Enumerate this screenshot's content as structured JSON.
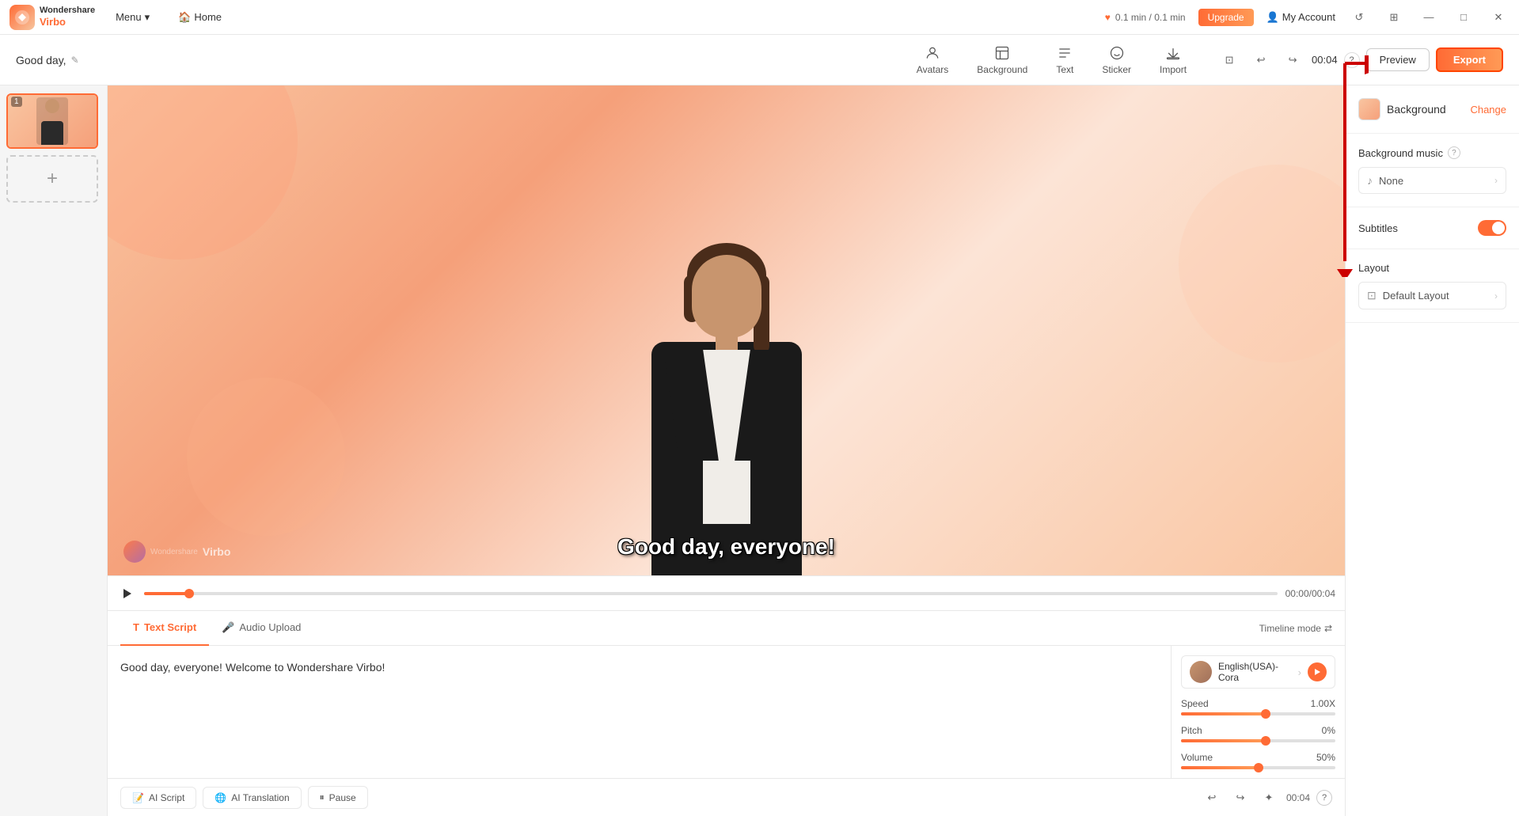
{
  "app": {
    "logo_text": "Wondershare\nVirbo",
    "logo_abbr": "W"
  },
  "top_nav": {
    "menu_label": "Menu",
    "home_label": "Home",
    "time_info": "0.1 min / 0.1 min",
    "upgrade_label": "Upgrade",
    "account_label": "My Account"
  },
  "toolbar": {
    "good_day_label": "Good day,",
    "avatars_label": "Avatars",
    "background_label": "Background",
    "text_label": "Text",
    "sticker_label": "Sticker",
    "import_label": "Import",
    "time_display": "00:04",
    "preview_label": "Preview",
    "export_label": "Export"
  },
  "slides": {
    "items": [
      {
        "num": "1",
        "label": "Slide 1"
      }
    ],
    "add_label": "+"
  },
  "canvas": {
    "subtitle_text": "Good day, everyone!",
    "watermark_text": "Virbo"
  },
  "timeline": {
    "time_display": "00:00/00:04",
    "progress_percent": 4
  },
  "script": {
    "text_script_label": "Text Script",
    "audio_upload_label": "Audio Upload",
    "timeline_mode_label": "Timeline mode",
    "script_content": "Good day, everyone! Welcome to Wondershare Virbo!",
    "voice_name": "English(USA)-Cora",
    "speed_label": "Speed",
    "speed_value": "1.00X",
    "pitch_label": "Pitch",
    "pitch_value": "0%",
    "volume_label": "Volume",
    "volume_value": "50%",
    "speed_percent": 55,
    "pitch_percent": 55,
    "volume_percent": 50
  },
  "bottom_toolbar": {
    "ai_script_label": "AI Script",
    "ai_translation_label": "AI Translation",
    "pause_label": "Pause",
    "time_badge": "00:04"
  },
  "right_panel": {
    "background_label": "Background",
    "change_label": "Change",
    "bg_music_label": "Background music",
    "none_label": "None",
    "subtitles_label": "Subtitles",
    "layout_label": "Layout",
    "default_layout_label": "Default Layout"
  }
}
